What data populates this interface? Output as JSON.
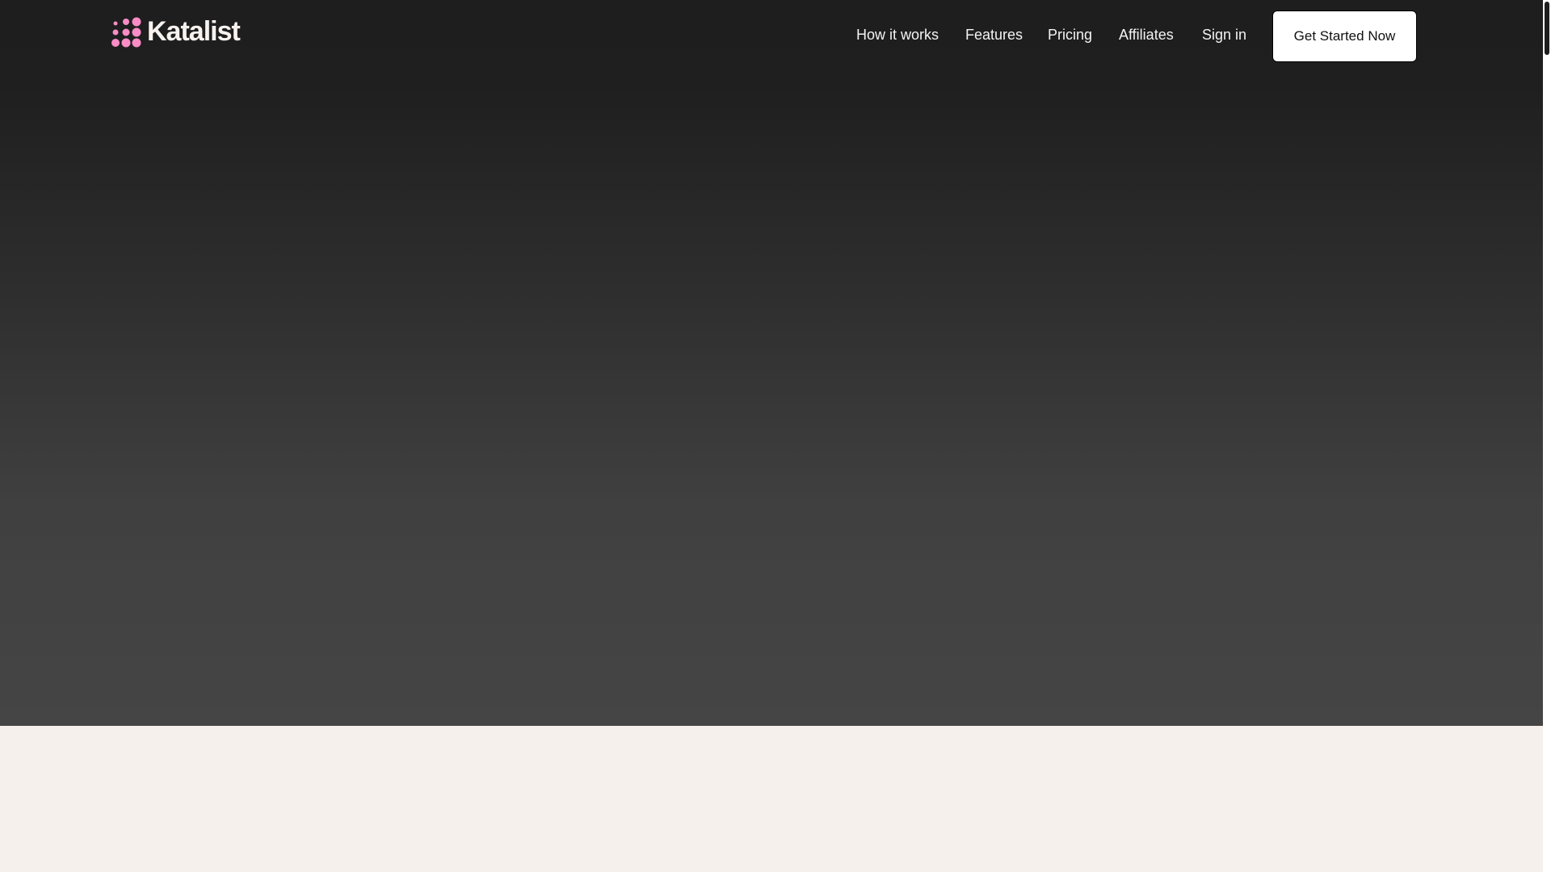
{
  "brand": {
    "name": "Katalist",
    "dot_color": "#f98cc6"
  },
  "nav": {
    "items": [
      {
        "label": "How it works"
      },
      {
        "label": "Features"
      },
      {
        "label": "Pricing"
      },
      {
        "label": "Affiliates"
      },
      {
        "label": "Sign in"
      }
    ],
    "cta": "Get Started Now"
  }
}
